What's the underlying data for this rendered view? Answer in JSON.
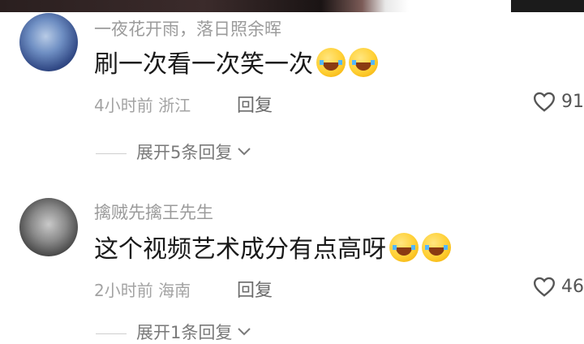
{
  "comments": [
    {
      "username": "一夜花开雨，落日照余晖",
      "text": "刷一次看一次笑一次",
      "emoji_count": 2,
      "time": "4小时前",
      "location": "浙江",
      "reply_label": "回复",
      "likes": "91",
      "expand_label": "展开5条回复"
    },
    {
      "username": "擒贼先擒王先生",
      "text": "这个视频艺术成分有点高呀",
      "emoji_count": 2,
      "time": "2小时前",
      "location": "海南",
      "reply_label": "回复",
      "likes": "46",
      "expand_label": "展开1条回复"
    }
  ],
  "icons": {
    "like": "heart-outline-icon",
    "emoji": "laughing-crying-emoji-icon",
    "expand": "chevron-down-icon"
  }
}
